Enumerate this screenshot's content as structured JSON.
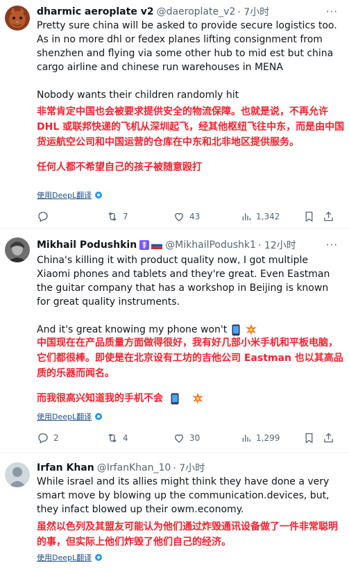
{
  "translate_label": "使用DeepL翻译",
  "tweets": [
    {
      "name": "dharmic aeroplate v2",
      "handle": "@daeroplate_v2",
      "time": "· 7小时",
      "text": [
        "Pretty sure china will be asked to provide secure logistics too. As in no more dhl or fedex planes lifting consignment from shenzhen and flying via some other hub to mid est but china cargo airline and chinese run warehouses in MENA",
        "Nobody wants their children randomly hit"
      ],
      "translation": [
        "非常肯定中国也会被要求提供安全的物流保障。也就是说，不再允许 DHL 或联邦快递的飞机从深圳起飞，经其他枢纽飞往中东，而是由中国货运航空公司和中国运营的仓库在中东和北非地区提供服务。",
        "任何人都不希望自己的孩子被随意殴打"
      ],
      "replies": "",
      "retweets": "7",
      "likes": "43",
      "views": "1,342"
    },
    {
      "name": "Mikhail Podushkin",
      "handle": "@MikhailPodushk1",
      "time": "· 12小时",
      "badge_icons": [
        "orthodox-cross-icon",
        "russia-flag-icon"
      ],
      "text": [
        "China's killing it with product quality now, I got multiple Xiaomi phones and tablets and they're great. Even Eastman the guitar company that has a workshop in Beijing is known for great quality instruments.",
        "And it's great knowing my phone won't"
      ],
      "translation": [
        "中国现在在产品质量方面做得很好，我有好几部小米手机和平板电脑，它们都很棒。即使是在北京设有工坊的吉他公司 Eastman 也以其高品质的乐器而闻名。",
        "而我很高兴知道我的手机不会"
      ],
      "replies": "2",
      "retweets": "4",
      "likes": "30",
      "views": "1,299"
    },
    {
      "name": "Irfan Khan",
      "handle": "@IrfanKhan_10",
      "time": "· 7小时",
      "text": [
        "While israel and its allies might think they have done a very smart move by blowing up the communication.devices, but, they infact blowed up their owm.economy."
      ],
      "translation": [
        "虽然以色列及其盟友可能认为他们通过炸毁通讯设备做了一件非常聪明的事，但实际上他们炸毁了他们自己的经济。"
      ]
    }
  ],
  "colors": {
    "translation": "#f4212e",
    "link": "#1d9bf0",
    "secondary": "#536471",
    "separator": "#eff3f4"
  }
}
